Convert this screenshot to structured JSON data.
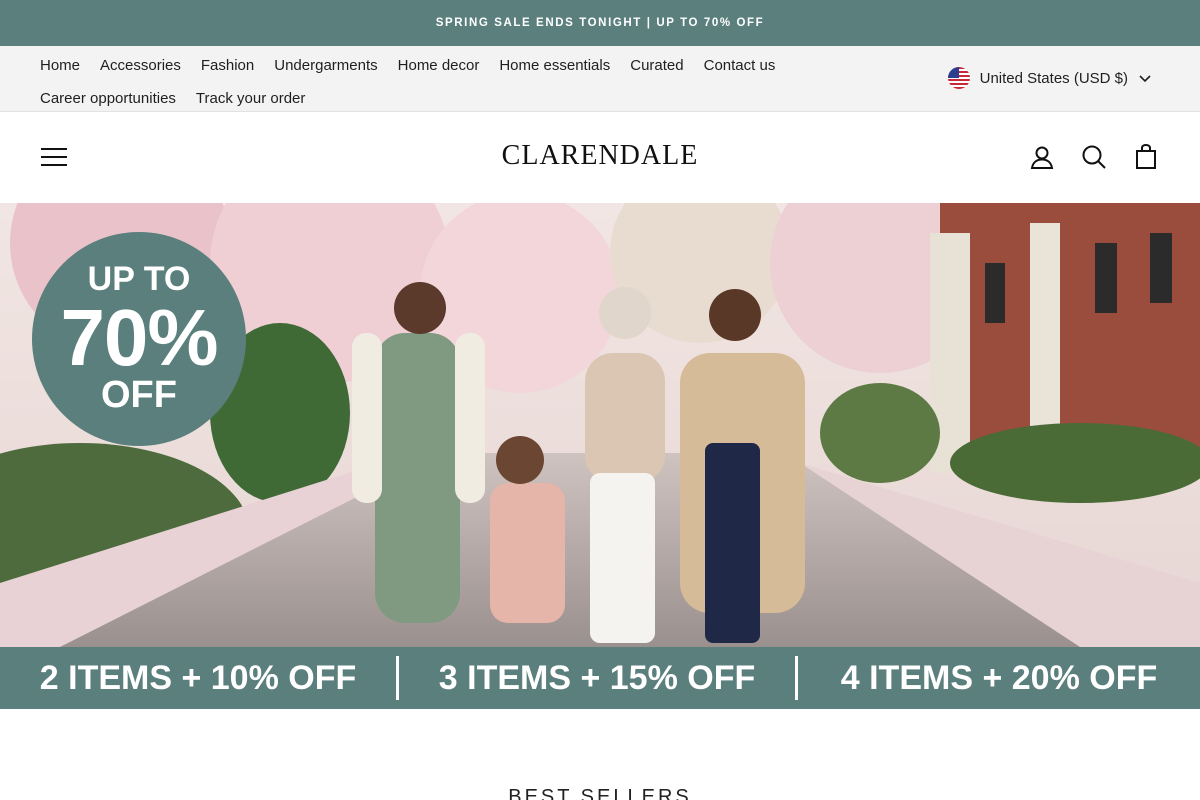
{
  "announcement": {
    "text": "SPRING SALE ENDS TONIGHT | UP TO 70% OFF"
  },
  "utility_nav": {
    "links": [
      {
        "label": "Home"
      },
      {
        "label": "Accessories"
      },
      {
        "label": "Fashion"
      },
      {
        "label": "Undergarments"
      },
      {
        "label": "Home decor"
      },
      {
        "label": "Home essentials"
      },
      {
        "label": "Curated"
      },
      {
        "label": "Contact us"
      },
      {
        "label": "Career opportunities"
      },
      {
        "label": "Track your order"
      }
    ],
    "currency": {
      "label": "United States (USD $)",
      "flag_icon": "us-flag-icon",
      "chevron_icon": "chevron-down-icon"
    }
  },
  "header": {
    "logo_text": "CLARENDALE",
    "icons": {
      "menu": "hamburger-menu-icon",
      "account": "user-account-icon",
      "search": "search-icon",
      "cart": "shopping-bag-icon"
    }
  },
  "hero": {
    "badge": {
      "line1": "UP TO",
      "line2": "70%",
      "line3": "OFF"
    }
  },
  "promo_tiers": [
    {
      "label": "2 ITEMS + 10% OFF"
    },
    {
      "label": "3 ITEMS + 15% OFF"
    },
    {
      "label": "4 ITEMS + 20% OFF"
    }
  ],
  "section": {
    "title": "BEST SELLERS"
  },
  "colors": {
    "brand": "#5a7f7c",
    "utility_bg": "#f3f3f3",
    "text": "#1a1a1a"
  }
}
